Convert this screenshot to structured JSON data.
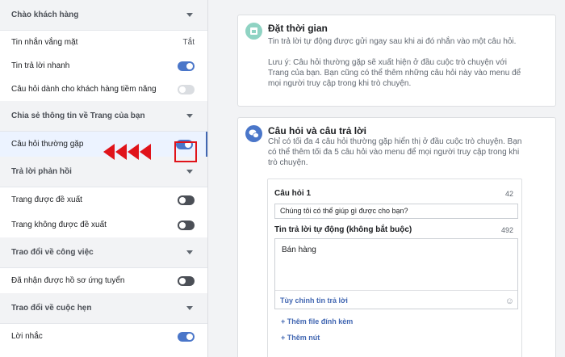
{
  "sidebar": {
    "sections": [
      {
        "title": "Chào khách hàng",
        "rows": [
          {
            "label": "Tin nhắn vắng mặt",
            "value": "Tắt"
          },
          {
            "label": "Tin trả lời nhanh",
            "toggle": "on"
          },
          {
            "label": "Câu hỏi dành cho khách hàng tiềm năng",
            "toggle": "disabled"
          }
        ]
      },
      {
        "title": "Chia sẻ thông tin về Trang của bạn",
        "rows": [
          {
            "label": "Câu hỏi thường gặp",
            "toggle": "on",
            "selected": true
          }
        ]
      },
      {
        "title": "Trả lời phản hồi",
        "rows": [
          {
            "label": "Trang được đề xuất",
            "toggle": "off"
          },
          {
            "label": "Trang không được đề xuất",
            "toggle": "off"
          }
        ]
      },
      {
        "title": "Trao đổi về công việc",
        "rows": [
          {
            "label": "Đã nhận được hồ sơ ứng tuyển",
            "toggle": "off"
          }
        ]
      },
      {
        "title": "Trao đổi về cuộc hẹn",
        "rows": [
          {
            "label": "Lời nhắc",
            "toggle": "on"
          }
        ]
      }
    ]
  },
  "card_schedule": {
    "title": "Đặt thời gian",
    "desc": "Tin trả lời tự động được gửi ngay sau khi ai đó nhắn vào một câu hỏi.",
    "note_line1": "Lưu ý: Câu hỏi thường gặp sẽ xuất hiện ở đầu cuộc trò chuyện với",
    "note_line2": "Trang của bạn. Bạn cũng có thể thêm những câu hỏi này vào menu để",
    "note_line3": "mọi người truy cập trong khi trò chuyện."
  },
  "card_faq": {
    "title": "Câu hỏi và câu trả lời",
    "desc_line1": "Chỉ có tối đa 4 câu hỏi thường gặp hiển thị ở đầu cuộc trò chuyện. Bạn",
    "desc_line2": "có thể thêm tối đa 5 câu hỏi vào menu để mọi người truy cập trong khi",
    "desc_line3": "trò chuyện.",
    "question_label": "Câu hỏi 1",
    "question_count": "42",
    "question_value": "Chúng tôi có thể giúp gì được cho bạn?",
    "answer_label": "Tin trả lời tự động (không bắt buộc)",
    "answer_count": "492",
    "answer_value": "Bán hàng",
    "customize_label": "Tùy chỉnh tin trả lời",
    "add_file_label": "+ Thêm file đính kèm",
    "add_button_label": "+ Thêm nút"
  },
  "colors": {
    "accent": "#4267b2",
    "toggle_on": "#4a76c9",
    "highlight": "#e0131a"
  }
}
